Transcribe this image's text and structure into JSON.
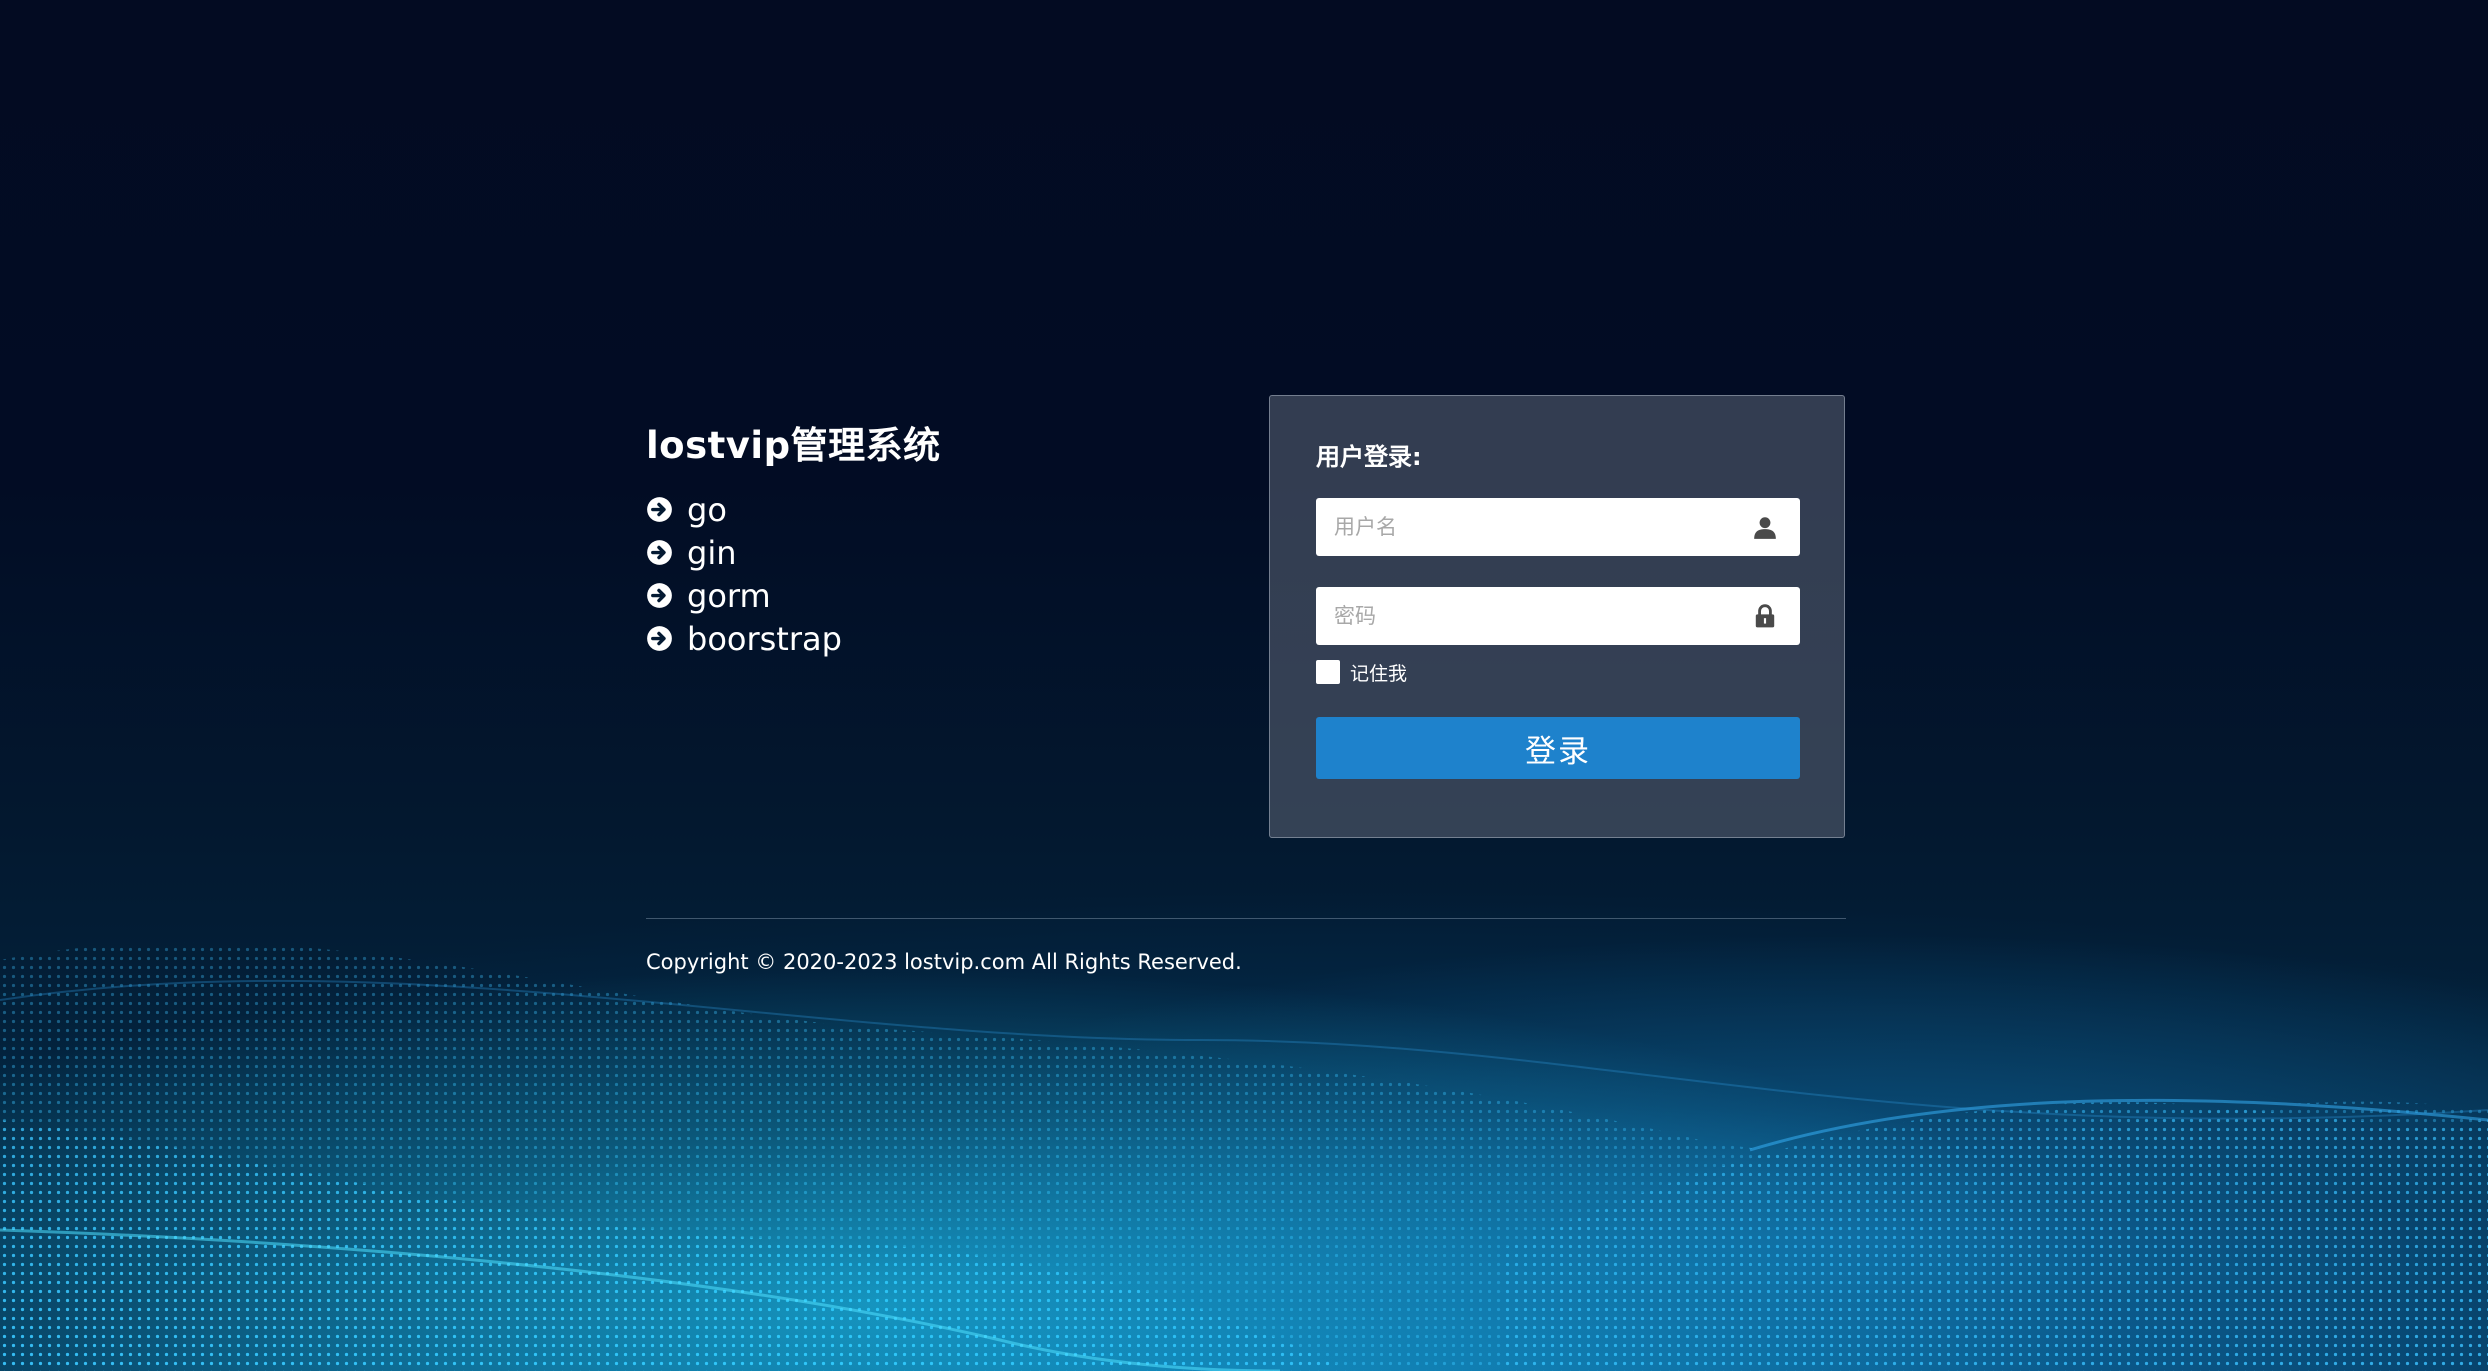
{
  "intro": {
    "title": "lostvip管理系统",
    "features": [
      {
        "label": "go",
        "icon": "arrow-circle-right-icon"
      },
      {
        "label": "gin",
        "icon": "arrow-circle-right-icon"
      },
      {
        "label": "gorm",
        "icon": "arrow-circle-right-icon"
      },
      {
        "label": "boorstrap",
        "icon": "arrow-circle-right-icon"
      }
    ]
  },
  "login": {
    "heading": "用户登录:",
    "username": {
      "value": "",
      "placeholder": "用户名",
      "icon": "user-icon"
    },
    "password": {
      "value": "",
      "placeholder": "密码",
      "icon": "lock-icon"
    },
    "remember": {
      "label": "记住我",
      "checked": false
    },
    "submit_label": "登录"
  },
  "footer": {
    "copyright": "Copyright © 2020-2023 lostvip.com All Rights Reserved."
  },
  "colors": {
    "button": "#1e82cc",
    "background_dark": "#030b22",
    "wave_glow": "#14b4f0"
  }
}
